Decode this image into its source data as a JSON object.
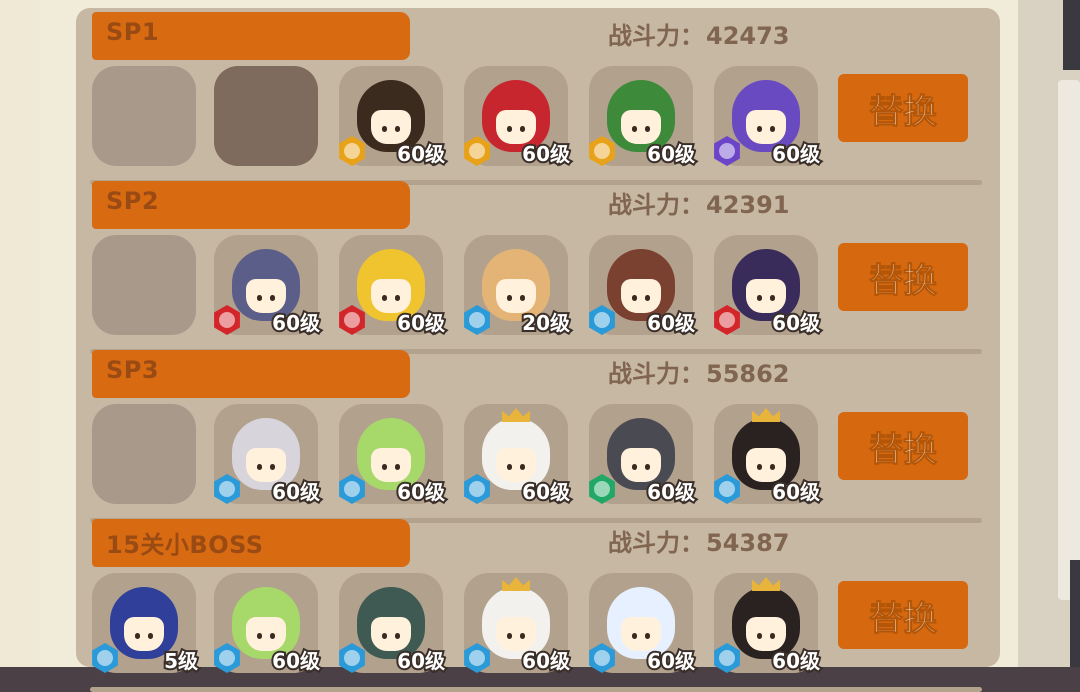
{
  "teams": [
    {
      "title": "SP1",
      "power_label": "战斗力：",
      "power_value": "42473",
      "replace_label": "替换",
      "slots": [
        {
          "type": "empty",
          "shade": "light"
        },
        {
          "type": "empty",
          "shade": "dark"
        },
        {
          "type": "char",
          "name": "brown-hat-girl",
          "level": "60级",
          "element": "gold",
          "hair": "#3b2a1e"
        },
        {
          "type": "char",
          "name": "red-curly-hair-girl",
          "level": "60级",
          "element": "gold",
          "hair": "#c8262f"
        },
        {
          "type": "char",
          "name": "green-hair-girl",
          "level": "60级",
          "element": "gold",
          "hair": "#3e8a3b"
        },
        {
          "type": "char",
          "name": "purple-flame-girl",
          "level": "60级",
          "element": "purple",
          "hair": "#6a4ac0"
        }
      ]
    },
    {
      "title": "SP2",
      "power_label": "战斗力：",
      "power_value": "42391",
      "replace_label": "替换",
      "slots": [
        {
          "type": "empty",
          "shade": "light"
        },
        {
          "type": "char",
          "name": "crystal-helm-character",
          "level": "60级",
          "element": "red",
          "hair": "#5c5e8a"
        },
        {
          "type": "char",
          "name": "yellow-feather-girl",
          "level": "60级",
          "element": "red",
          "hair": "#f0c42e"
        },
        {
          "type": "char",
          "name": "ram-horn-girl",
          "level": "20级",
          "element": "blue",
          "hair": "#e4b476"
        },
        {
          "type": "char",
          "name": "red-panda-girl",
          "level": "60级",
          "element": "blue",
          "hair": "#7a4030"
        },
        {
          "type": "char",
          "name": "dark-spirit-character",
          "level": "60级",
          "element": "red",
          "hair": "#3a2c5a"
        }
      ]
    },
    {
      "title": "SP3",
      "power_label": "战斗力：",
      "power_value": "55862",
      "replace_label": "替换",
      "slots": [
        {
          "type": "empty",
          "shade": "light"
        },
        {
          "type": "char",
          "name": "white-feather-girl",
          "level": "60级",
          "element": "blue",
          "hair": "#d8d4dc"
        },
        {
          "type": "char",
          "name": "green-frog-girl",
          "level": "60级",
          "element": "blue",
          "hair": "#a6d86a"
        },
        {
          "type": "char",
          "name": "white-crown-girl",
          "level": "60级",
          "element": "blue",
          "hair": "#f3f1ee"
        },
        {
          "type": "char",
          "name": "deer-antler-girl",
          "level": "60级",
          "element": "green",
          "hair": "#4a4a52"
        },
        {
          "type": "char",
          "name": "laurel-wreath-girl",
          "level": "60级",
          "element": "blue",
          "hair": "#2a2220"
        }
      ]
    },
    {
      "title": "15关小BOSS",
      "power_label": "战斗力：",
      "power_value": "54387",
      "replace_label": "替换",
      "slots": [
        {
          "type": "char",
          "name": "blue-slug-creature",
          "level": "5级",
          "element": "blue",
          "hair": "#2f3f9a"
        },
        {
          "type": "char",
          "name": "green-frog-girl",
          "level": "60级",
          "element": "blue",
          "hair": "#a6d86a"
        },
        {
          "type": "char",
          "name": "teal-headphones-boy",
          "level": "60级",
          "element": "blue",
          "hair": "#3e5a52"
        },
        {
          "type": "char",
          "name": "white-crown-girl",
          "level": "60级",
          "element": "blue",
          "hair": "#f3f1ee"
        },
        {
          "type": "char",
          "name": "ice-crystal-girl",
          "level": "60级",
          "element": "blue",
          "hair": "#e6f0ff"
        },
        {
          "type": "char",
          "name": "laurel-wreath-girl",
          "level": "60级",
          "element": "blue",
          "hair": "#2a2220"
        }
      ]
    }
  ],
  "element_colors": {
    "gold": "#e8a21a",
    "purple": "#6b45c8",
    "red": "#d3262a",
    "blue": "#2a9ad8",
    "green": "#22a866"
  }
}
